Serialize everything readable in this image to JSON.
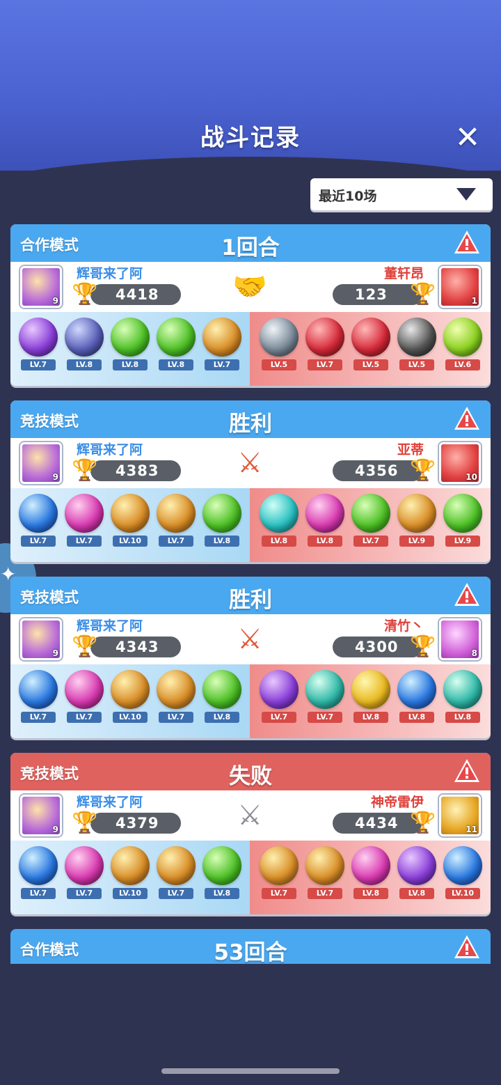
{
  "header": {
    "title": "战斗记录",
    "close_label": "✕"
  },
  "filter": {
    "selected": "最近10场"
  },
  "records": [
    {
      "mode": "合作模式",
      "result": "1回合",
      "header_color": "blue",
      "vs": "handshake",
      "left": {
        "name": "辉哥来了阿",
        "trophies": "4418",
        "avatar_level": "9",
        "heroes": [
          {
            "icon": "c-purple",
            "lv": "LV.7"
          },
          {
            "icon": "c-stone",
            "lv": "LV.8"
          },
          {
            "icon": "c-green",
            "lv": "LV.8"
          },
          {
            "icon": "c-green",
            "lv": "LV.8"
          },
          {
            "icon": "c-gold",
            "lv": "LV.7"
          }
        ]
      },
      "right": {
        "name": "董轩昂",
        "trophies": "123",
        "avatar_level": "1",
        "avatar": "av-fire",
        "heroes": [
          {
            "icon": "c-grey",
            "lv": "LV.5"
          },
          {
            "icon": "c-red",
            "lv": "LV.7"
          },
          {
            "icon": "c-red",
            "lv": "LV.5"
          },
          {
            "icon": "c-dark",
            "lv": "LV.5"
          },
          {
            "icon": "c-lime",
            "lv": "LV.6"
          }
        ]
      }
    },
    {
      "mode": "竞技模式",
      "result": "胜利",
      "header_color": "blue",
      "vs": "swords",
      "left": {
        "name": "辉哥来了阿",
        "trophies": "4383",
        "avatar_level": "9",
        "heroes": [
          {
            "icon": "c-blue",
            "lv": "LV.7"
          },
          {
            "icon": "c-pink",
            "lv": "LV.7"
          },
          {
            "icon": "c-gold",
            "lv": "LV.10"
          },
          {
            "icon": "c-gold",
            "lv": "LV.7"
          },
          {
            "icon": "c-green",
            "lv": "LV.8"
          }
        ]
      },
      "right": {
        "name": "亚蒂",
        "trophies": "4356",
        "avatar_level": "10",
        "avatar": "av-fire",
        "heroes": [
          {
            "icon": "c-cyan",
            "lv": "LV.8"
          },
          {
            "icon": "c-pink",
            "lv": "LV.8"
          },
          {
            "icon": "c-green",
            "lv": "LV.7"
          },
          {
            "icon": "c-gold",
            "lv": "LV.9"
          },
          {
            "icon": "c-green",
            "lv": "LV.9"
          }
        ]
      }
    },
    {
      "mode": "竞技模式",
      "result": "胜利",
      "header_color": "blue",
      "vs": "swords",
      "left": {
        "name": "辉哥来了阿",
        "trophies": "4343",
        "avatar_level": "9",
        "heroes": [
          {
            "icon": "c-blue",
            "lv": "LV.7"
          },
          {
            "icon": "c-pink",
            "lv": "LV.7"
          },
          {
            "icon": "c-gold",
            "lv": "LV.10"
          },
          {
            "icon": "c-gold",
            "lv": "LV.7"
          },
          {
            "icon": "c-green",
            "lv": "LV.8"
          }
        ]
      },
      "right": {
        "name": "清竹丶",
        "trophies": "4300",
        "avatar_level": "8",
        "avatar": "av-pink",
        "heroes": [
          {
            "icon": "c-purple",
            "lv": "LV.7"
          },
          {
            "icon": "c-teal",
            "lv": "LV.7"
          },
          {
            "icon": "c-yellow",
            "lv": "LV.8"
          },
          {
            "icon": "c-blue",
            "lv": "LV.8"
          },
          {
            "icon": "c-teal",
            "lv": "LV.8"
          }
        ]
      }
    },
    {
      "mode": "竞技模式",
      "result": "失败",
      "header_color": "red",
      "vs": "swords-grey",
      "left": {
        "name": "辉哥来了阿",
        "trophies": "4379",
        "avatar_level": "9",
        "heroes": [
          {
            "icon": "c-blue",
            "lv": "LV.7"
          },
          {
            "icon": "c-pink",
            "lv": "LV.7"
          },
          {
            "icon": "c-gold",
            "lv": "LV.10"
          },
          {
            "icon": "c-gold",
            "lv": "LV.7"
          },
          {
            "icon": "c-green",
            "lv": "LV.8"
          }
        ]
      },
      "right": {
        "name": "神帝雷伊",
        "trophies": "4434",
        "avatar_level": "11",
        "avatar": "av-gold",
        "heroes": [
          {
            "icon": "c-gold",
            "lv": "LV.7"
          },
          {
            "icon": "c-gold",
            "lv": "LV.7"
          },
          {
            "icon": "c-pink",
            "lv": "LV.8"
          },
          {
            "icon": "c-purple",
            "lv": "LV.8"
          },
          {
            "icon": "c-blue",
            "lv": "LV.10"
          }
        ]
      }
    }
  ],
  "partial_record": {
    "mode": "合作模式",
    "result": "53回合"
  },
  "colors": {
    "blue_header": "#4aa8f0",
    "red_header": "#e0625e",
    "background": "#2f3352"
  }
}
